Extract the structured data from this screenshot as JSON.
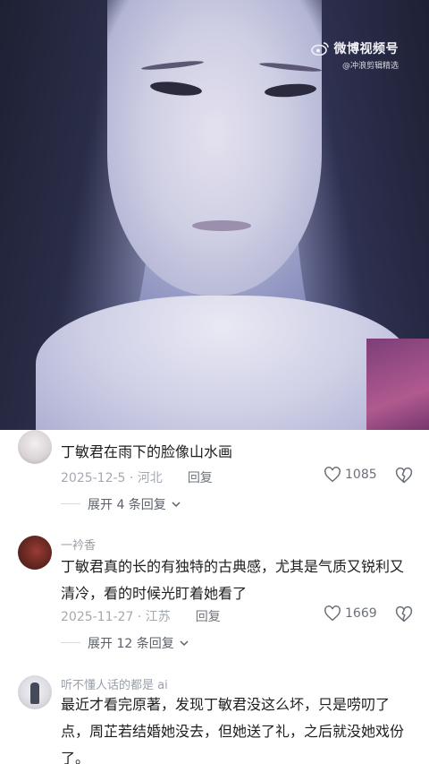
{
  "video": {
    "watermark_title": "微博视频号",
    "watermark_handle": "@冲浪剪辑精选"
  },
  "comments": [
    {
      "username": "",
      "text": "丁敏君在雨下的脸像山水画",
      "date_location": "2025-12-5 · 河北",
      "reply_label": "回复",
      "likes": "1085",
      "expand_label": "展开 4 条回复"
    },
    {
      "username": "一衿香",
      "text": "丁敏君真的长的有独特的古典感，尤其是气质又锐利又清冷，看的时候光盯着她看了",
      "date_location": "2025-11-27 · 江苏",
      "reply_label": "回复",
      "likes": "1669",
      "expand_label": "展开 12 条回复"
    },
    {
      "username": "听不懂人话的都是 ai",
      "text": "最近才看完原著，发现丁敏君没这么坏，只是唠叨了点，周芷若结婚她没去，但她送了礼，之后就没她戏份了。"
    }
  ],
  "colors": {
    "meta_gray": "#a4a9b0",
    "text": "#1e1e1e",
    "video_tint": "#8b90bd"
  }
}
